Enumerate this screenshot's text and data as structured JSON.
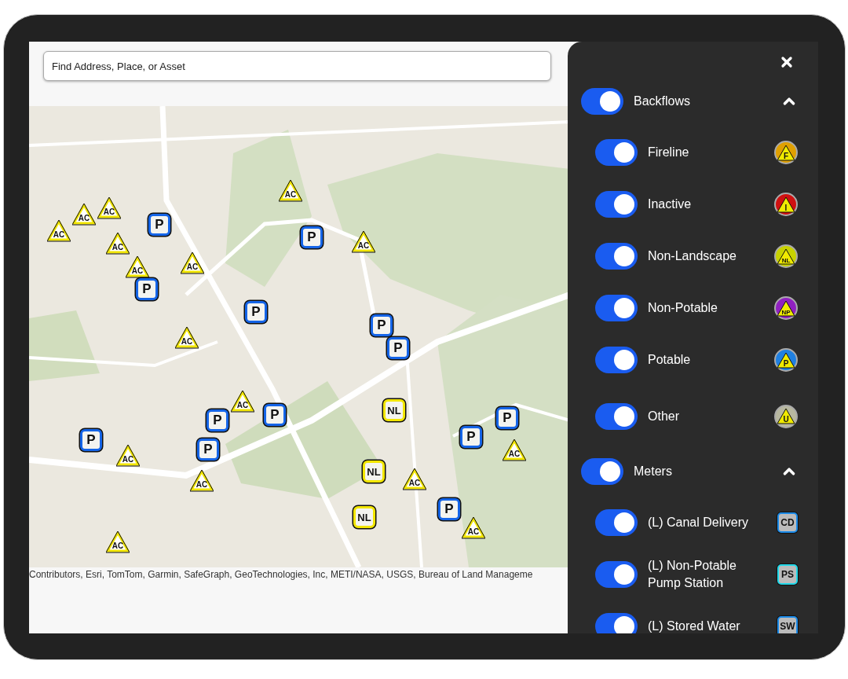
{
  "search": {
    "placeholder": "Find Address, Place, or Asset"
  },
  "map": {
    "markers": [
      {
        "kind": "triangle",
        "label": "AC",
        "color": "#f2e600"
      },
      {
        "kind": "triangle",
        "label": "AC",
        "color": "#f2e600"
      },
      {
        "kind": "triangle",
        "label": "AC",
        "color": "#f2e600"
      },
      {
        "kind": "triangle",
        "label": "AC",
        "color": "#f2e600"
      },
      {
        "kind": "triangle",
        "label": "AC",
        "color": "#f2e600"
      },
      {
        "kind": "triangle",
        "label": "AC",
        "color": "#f2e600"
      },
      {
        "kind": "triangle",
        "label": "AC",
        "color": "#f2e600"
      },
      {
        "kind": "triangle",
        "label": "AC",
        "color": "#f2e600"
      },
      {
        "kind": "triangle",
        "label": "AC",
        "color": "#f2e600"
      },
      {
        "kind": "triangle",
        "label": "AC",
        "color": "#f2e600"
      },
      {
        "kind": "triangle",
        "label": "AC",
        "color": "#f2e600"
      },
      {
        "kind": "triangle",
        "label": "AC",
        "color": "#f2e600"
      },
      {
        "kind": "triangle",
        "label": "AC",
        "color": "#f2e600"
      },
      {
        "kind": "triangle",
        "label": "AC",
        "color": "#f2e600"
      },
      {
        "kind": "triangle",
        "label": "AC",
        "color": "#f2e600"
      },
      {
        "kind": "triangle",
        "label": "AC",
        "color": "#f2e600"
      },
      {
        "kind": "square",
        "label": "P",
        "color": "#1565e8"
      },
      {
        "kind": "square",
        "label": "P",
        "color": "#1565e8"
      },
      {
        "kind": "square",
        "label": "P",
        "color": "#1565e8"
      },
      {
        "kind": "square",
        "label": "P",
        "color": "#1565e8"
      },
      {
        "kind": "square",
        "label": "P",
        "color": "#1565e8"
      },
      {
        "kind": "square",
        "label": "P",
        "color": "#1565e8"
      },
      {
        "kind": "square",
        "label": "P",
        "color": "#1565e8"
      },
      {
        "kind": "square",
        "label": "P",
        "color": "#1565e8"
      },
      {
        "kind": "square",
        "label": "P",
        "color": "#1565e8"
      },
      {
        "kind": "square",
        "label": "P",
        "color": "#1565e8"
      },
      {
        "kind": "square",
        "label": "P",
        "color": "#1565e8"
      },
      {
        "kind": "square",
        "label": "P",
        "color": "#1565e8"
      },
      {
        "kind": "square",
        "label": "P",
        "color": "#1565e8"
      },
      {
        "kind": "square",
        "label": "NL",
        "color": "#f2e600"
      },
      {
        "kind": "square",
        "label": "NL",
        "color": "#f2e600"
      },
      {
        "kind": "square",
        "label": "NL",
        "color": "#f2e600"
      }
    ]
  },
  "attribution": "Contributors, Esri, TomTom, Garmin, SafeGraph, GeoTechnologies, Inc, METI/NASA, USGS, Bureau of Land Manageme",
  "panel": {
    "groups": [
      {
        "label": "Backflows",
        "on": true,
        "expanded": true,
        "items": [
          {
            "label": "Fireline",
            "on": true,
            "kind": "backflow",
            "code": "F",
            "color": "#e0a000"
          },
          {
            "label": "Inactive",
            "on": true,
            "kind": "backflow",
            "code": "I",
            "color": "#d01010"
          },
          {
            "label": "Non-Landscape",
            "on": true,
            "kind": "backflow",
            "code": "NL",
            "color": "#c8d200"
          },
          {
            "label": "Non-Potable",
            "on": true,
            "kind": "backflow",
            "code": "NP",
            "color": "#9020c0"
          },
          {
            "label": "Potable",
            "on": true,
            "kind": "backflow",
            "code": "P",
            "color": "#2080e0"
          },
          {
            "label": "Other",
            "on": true,
            "kind": "backflow",
            "code": "U",
            "color": "#b8b8a0"
          }
        ]
      },
      {
        "label": "Meters",
        "on": true,
        "expanded": true,
        "items": [
          {
            "label": "(L) Canal Delivery",
            "on": true,
            "kind": "meter",
            "code": "CD",
            "color": "#1a8ae8"
          },
          {
            "label": "(L) Non-Potable Pump Station",
            "on": true,
            "kind": "meter",
            "code": "PS",
            "color": "#20d8e8"
          },
          {
            "label": "(L) Stored Water",
            "on": true,
            "kind": "meter",
            "code": "SW",
            "color": "#1a8ae8"
          }
        ]
      }
    ]
  }
}
